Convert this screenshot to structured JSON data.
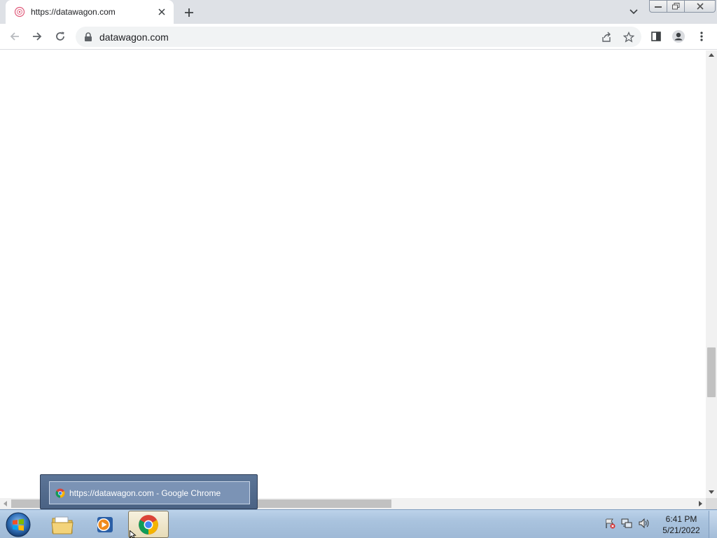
{
  "browser": {
    "tab": {
      "title": "https://datawagon.com",
      "favicon": "site-favicon-icon"
    },
    "toolbar": {
      "url": "datawagon.com"
    },
    "colors": {
      "tabstrip": "#dee1e6",
      "omnibox": "#f1f3f4"
    }
  },
  "taskbar": {
    "clock_time": "6:41 PM",
    "clock_date": "5/21/2022",
    "items": [
      {
        "name": "windows-explorer",
        "icon": "folder-icon"
      },
      {
        "name": "media-player",
        "icon": "media-player-icon"
      },
      {
        "name": "google-chrome",
        "icon": "chrome-icon",
        "active": true
      }
    ]
  },
  "thumbnail_popup": {
    "label": "https://datawagon.com - Google Chrome"
  }
}
